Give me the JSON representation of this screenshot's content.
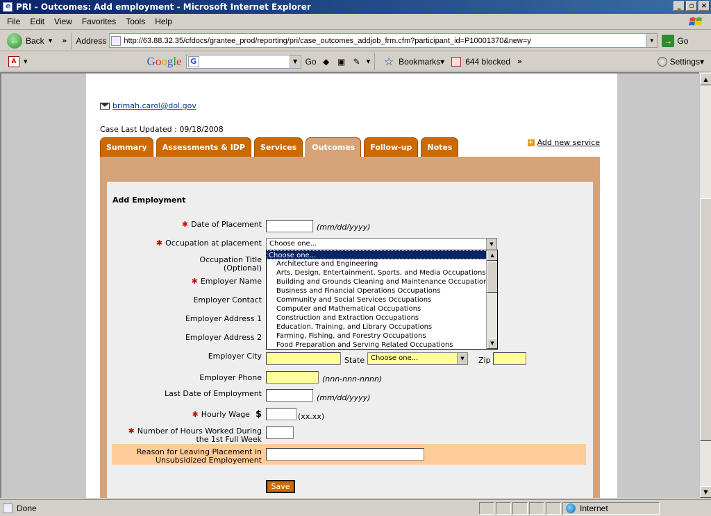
{
  "window": {
    "title": "PRI - Outcomes: Add employment - Microsoft Internet Explorer",
    "controls": [
      "_",
      "▫",
      "×"
    ]
  },
  "menu": [
    "File",
    "Edit",
    "View",
    "Favorites",
    "Tools",
    "Help"
  ],
  "addressbar": {
    "back_label": "Back",
    "address_label": "Address",
    "url": "http://63.88.32.35/cfdocs/grantee_prod/reporting/pri/case_outcomes_addjob_frm.cfm?participant_id=P10001370&new=y",
    "go_label": "Go"
  },
  "google_toolbar": {
    "go_label": "Go",
    "bookmarks_label": "Bookmarks▾",
    "blocked_label": "644 blocked",
    "settings_label": "Settings▾"
  },
  "page": {
    "email": "brimah.carol@dol.gov",
    "case_updated": "Case Last Updated : 09/18/2008",
    "tabs": [
      "Summary",
      "Assessments & IDP",
      "Services",
      "Outcomes",
      "Follow-up",
      "Notes"
    ],
    "active_tab": "Outcomes",
    "add_service": "Add new service",
    "form": {
      "title": "Add Employment",
      "date_of_placement": "Date of Placement",
      "date_hint": "(mm/dd/yyyy)",
      "occupation_at_placement": "Occupation at placement",
      "occupation_selected": "Choose one...",
      "occupation_title": "Occupation Title",
      "optional": "(Optional)",
      "employer_name": "Employer Name",
      "employer_contact": "Employer Contact",
      "employer_address1": "Employer Address 1",
      "employer_address2": "Employer Address 2",
      "employer_city": "Employer City",
      "state_label": "State",
      "state_selected": "Choose one...",
      "zip_label": "Zip",
      "employer_phone": "Employer Phone",
      "phone_hint": "(nnn-nnn-nnnn)",
      "last_date_employment": "Last Date of Employment",
      "last_date_hint": "(mm/dd/yyyy)",
      "hourly_wage": "Hourly Wage",
      "dollar": "$",
      "wage_hint": "(xx.xx)",
      "hours_worked_1": "Number of Hours Worked During",
      "hours_worked_2": "the 1st  Full Week",
      "reason_1": "Reason for Leaving Placement in",
      "reason_2": "Unsubsidized Employement",
      "save": "Save"
    },
    "occupation_options": [
      "Choose one...",
      "Architecture and Engineering",
      "Arts, Design, Entertainment, Sports, and Media Occupations",
      "Building and Grounds Cleaning and Maintenance Occupations",
      "Business and Financial Operations Occupations",
      "Community and Social Services Occupations",
      "Computer and Mathematical Occupations",
      "Construction and Extraction Occupations",
      "Education, Training, and Library Occupations",
      "Farming, Fishing, and Forestry Occupations",
      "Food Preparation and Serving Related Occupations"
    ]
  },
  "status": {
    "left": "Done",
    "zone": "Internet"
  }
}
